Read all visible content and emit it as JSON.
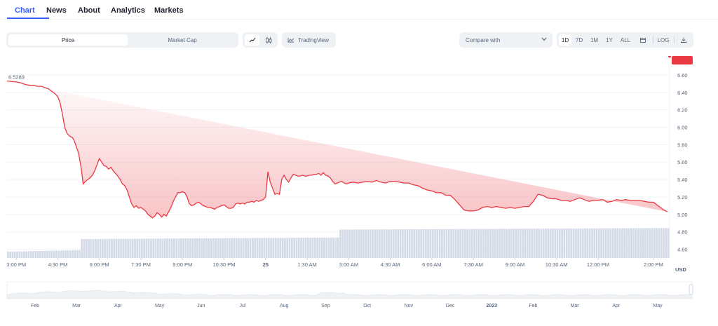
{
  "tabs": [
    {
      "label": "Chart",
      "active": true
    },
    {
      "label": "News",
      "active": false
    },
    {
      "label": "About",
      "active": false
    },
    {
      "label": "Analytics",
      "active": false
    },
    {
      "label": "Markets",
      "active": false
    }
  ],
  "toolbar": {
    "price_label": "Price",
    "market_cap_label": "Market Cap",
    "tradingview_label": "TradingView",
    "compare_label": "Compare with",
    "ranges": [
      "1D",
      "7D",
      "1M",
      "1Y",
      "ALL"
    ],
    "active_range": "1D",
    "log_label": "LOG",
    "line_icon": "line-chart-icon",
    "candle_icon": "candlestick-icon",
    "calendar_icon": "calendar-icon",
    "download_icon": "download-icon"
  },
  "colors": {
    "accent": "#3861fb",
    "price_line": "#ea3943",
    "volume_bar": "#cfd6e4"
  },
  "chart_data": {
    "type": "area",
    "open_label": "6.5289",
    "last_label": "5.03",
    "currency_label": "USD",
    "ylim": [
      4.5,
      6.72
    ],
    "yticks": [
      "6.60",
      "6.40",
      "6.20",
      "6.00",
      "5.80",
      "5.60",
      "5.40",
      "5.20",
      "5.00",
      "4.80",
      "4.60"
    ],
    "xticks": [
      "3:00 PM",
      "4:30 PM",
      "6:00 PM",
      "7:30 PM",
      "9:00 PM",
      "10:30 PM",
      "25",
      "1:30 AM",
      "3:00 AM",
      "4:30 AM",
      "6:00 AM",
      "7:30 AM",
      "9:00 AM",
      "10:30 AM",
      "12:00 PM",
      "2:00 PM"
    ],
    "xlim": [
      0,
      1415
    ],
    "xtick_positions": [
      0,
      90,
      180,
      270,
      360,
      450,
      540,
      630,
      720,
      810,
      900,
      990,
      1080,
      1170,
      1260,
      1380
    ],
    "price": {
      "t": [
        -20,
        0,
        10,
        20,
        30,
        40,
        45,
        55,
        60,
        65,
        70,
        75,
        80,
        85,
        90,
        95,
        100,
        105,
        110,
        115,
        122,
        125,
        130,
        135,
        140,
        145,
        150,
        155,
        160,
        165,
        170,
        175,
        180,
        185,
        190,
        195,
        200,
        205,
        210,
        215,
        220,
        225,
        230,
        235,
        240,
        245,
        250,
        255,
        260,
        265,
        270,
        275,
        280,
        285,
        290,
        295,
        300,
        305,
        310,
        315,
        320,
        325,
        330,
        335,
        340,
        345,
        350,
        355,
        360,
        365,
        370,
        375,
        380,
        385,
        390,
        395,
        400,
        405,
        410,
        415,
        420,
        425,
        430,
        435,
        440,
        445,
        450,
        455,
        460,
        465,
        470,
        475,
        480,
        485,
        490,
        495,
        500,
        505,
        510,
        515,
        520,
        525,
        530,
        535,
        540,
        545,
        550,
        555,
        560,
        565,
        570,
        575,
        580,
        585,
        590,
        595,
        600,
        605,
        610,
        615,
        620,
        625,
        630,
        635,
        640,
        645,
        650,
        655,
        660,
        665,
        670,
        675,
        680,
        685,
        690,
        695,
        700,
        705,
        710,
        715,
        720,
        730,
        740,
        750,
        760,
        770,
        780,
        790,
        800,
        810,
        820,
        830,
        840,
        850,
        860,
        870,
        880,
        890,
        900,
        910,
        920,
        930,
        940,
        950,
        960,
        970,
        980,
        990,
        1000,
        1010,
        1020,
        1030,
        1040,
        1050,
        1060,
        1070,
        1080,
        1090,
        1100,
        1110,
        1120,
        1130,
        1140,
        1150,
        1160,
        1170,
        1180,
        1190,
        1200,
        1210,
        1220,
        1230,
        1240,
        1250,
        1260,
        1270,
        1280,
        1290,
        1300,
        1310,
        1320,
        1330,
        1340,
        1350,
        1360,
        1370,
        1380,
        1390,
        1400,
        1410,
        1415
      ],
      "v": [
        6.53,
        6.52,
        6.51,
        6.49,
        6.48,
        6.48,
        6.47,
        6.47,
        6.46,
        6.45,
        6.44,
        6.42,
        6.4,
        6.38,
        6.35,
        6.28,
        6.15,
        6.0,
        5.93,
        5.9,
        5.88,
        5.85,
        5.78,
        5.7,
        5.55,
        5.35,
        5.38,
        5.4,
        5.42,
        5.45,
        5.5,
        5.57,
        5.64,
        5.6,
        5.56,
        5.55,
        5.52,
        5.54,
        5.5,
        5.47,
        5.44,
        5.4,
        5.35,
        5.33,
        5.28,
        5.2,
        5.12,
        5.08,
        5.1,
        5.07,
        5.08,
        5.06,
        5.04,
        5.0,
        4.98,
        4.96,
        4.98,
        5.02,
        5.0,
        4.97,
        5.0,
        4.98,
        5.03,
        5.08,
        5.15,
        5.2,
        5.25,
        5.25,
        5.26,
        5.25,
        5.2,
        5.12,
        5.1,
        5.11,
        5.13,
        5.14,
        5.12,
        5.1,
        5.09,
        5.08,
        5.08,
        5.07,
        5.06,
        5.08,
        5.09,
        5.1,
        5.11,
        5.09,
        5.07,
        5.07,
        5.08,
        5.12,
        5.13,
        5.12,
        5.13,
        5.12,
        5.14,
        5.14,
        5.15,
        5.14,
        5.16,
        5.15,
        5.16,
        5.17,
        5.2,
        5.49,
        5.37,
        5.3,
        5.23,
        5.24,
        5.23,
        5.4,
        5.45,
        5.4,
        5.37,
        5.42,
        5.46,
        5.45,
        5.44,
        5.44,
        5.45,
        5.44,
        5.44,
        5.45,
        5.45,
        5.46,
        5.46,
        5.47,
        5.45,
        5.48,
        5.45,
        5.44,
        5.42,
        5.38,
        5.35,
        5.36,
        5.37,
        5.38,
        5.36,
        5.35,
        5.36,
        5.37,
        5.36,
        5.37,
        5.38,
        5.37,
        5.39,
        5.37,
        5.36,
        5.38,
        5.38,
        5.37,
        5.36,
        5.36,
        5.34,
        5.33,
        5.3,
        5.28,
        5.27,
        5.25,
        5.25,
        5.22,
        5.22,
        5.17,
        5.11,
        5.05,
        5.04,
        5.04,
        5.05,
        5.08,
        5.09,
        5.08,
        5.09,
        5.08,
        5.07,
        5.08,
        5.07,
        5.08,
        5.09,
        5.09,
        5.15,
        5.23,
        5.22,
        5.19,
        5.18,
        5.18,
        5.16,
        5.16,
        5.15,
        5.17,
        5.19,
        5.17,
        5.15,
        5.16,
        5.16,
        5.17,
        5.14,
        5.15,
        5.17,
        5.16,
        5.17,
        5.16,
        5.16,
        5.16,
        5.15,
        5.14,
        5.14,
        5.1,
        5.06,
        5.03
      ]
    },
    "volume": {
      "start": -20,
      "end": 1415,
      "levels": [
        {
          "from": -20,
          "to": 140,
          "value": 0.06
        },
        {
          "from": 140,
          "to": 700,
          "value": 0.18
        },
        {
          "from": 700,
          "to": 1415,
          "value": 0.27
        }
      ]
    },
    "navigator": {
      "labels": [
        "Feb",
        "Mar",
        "Apr",
        "May",
        "Jun",
        "Jul",
        "Aug",
        "Sep",
        "Oct",
        "Nov",
        "Dec",
        "2023",
        "Feb",
        "Mar",
        "Apr",
        "May"
      ]
    }
  }
}
